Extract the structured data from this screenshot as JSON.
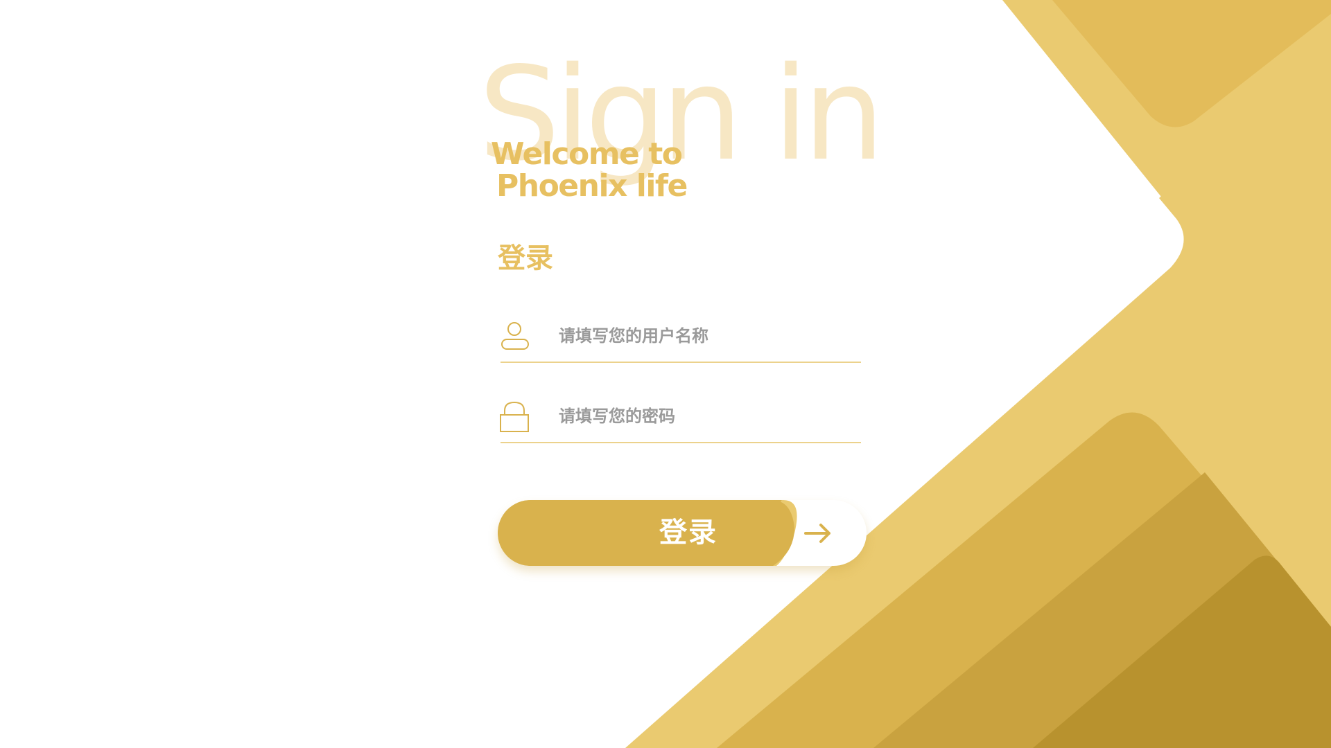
{
  "header": {
    "background_title": "Sign in",
    "welcome_line1": "Welcome to",
    "welcome_line2": "Phoenix life"
  },
  "form": {
    "heading": "登录",
    "username": {
      "placeholder": "请填写您的用户名称",
      "value": "",
      "icon": "user-icon"
    },
    "password": {
      "placeholder": "请填写您的密码",
      "value": "",
      "icon": "lock-icon"
    },
    "submit": {
      "label": "登录",
      "icon": "arrow-right-icon"
    }
  },
  "colors": {
    "accent": "#e7c061",
    "button": "#d9b24d",
    "faint_title": "#f7e7c4",
    "shape_light": "#eaca70",
    "shape_mid": "#d7b14e",
    "shape_dark": "#b8902c"
  }
}
